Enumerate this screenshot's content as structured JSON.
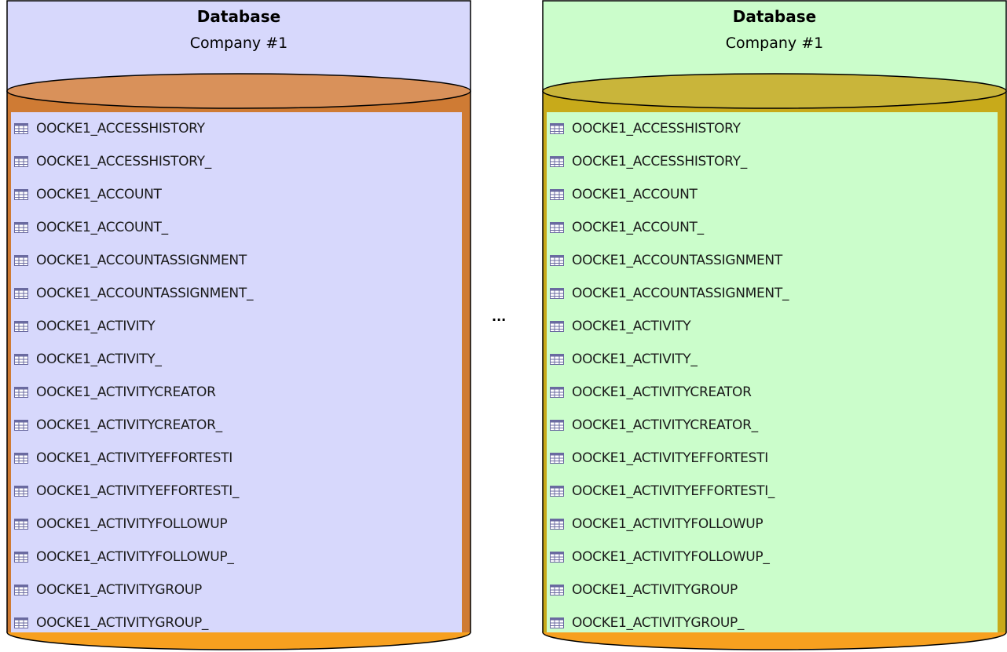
{
  "colors": {
    "left_body": "#d7d8fc",
    "left_rim": "#cf7b34",
    "left_top_ellipse": "#d9915a",
    "left_bottom": "#f7a01f",
    "right_body": "#cbfdcb",
    "right_rim": "#c8aa1a",
    "right_top_ellipse": "#c9b53a",
    "right_bottom": "#f7a01f",
    "outline": "#000000",
    "icon_table": "#6a6aa0"
  },
  "databases": [
    {
      "title": "Database",
      "subtitle": "Company #1",
      "icon": "table-icon",
      "tables": [
        "OOCKE1_ACCESSHISTORY",
        "OOCKE1_ACCESSHISTORY_",
        "OOCKE1_ACCOUNT",
        "OOCKE1_ACCOUNT_",
        "OOCKE1_ACCOUNTASSIGNMENT",
        "OOCKE1_ACCOUNTASSIGNMENT_",
        "OOCKE1_ACTIVITY",
        "OOCKE1_ACTIVITY_",
        "OOCKE1_ACTIVITYCREATOR",
        "OOCKE1_ACTIVITYCREATOR_",
        "OOCKE1_ACTIVITYEFFORTESTI",
        "OOCKE1_ACTIVITYEFFORTESTI_",
        "OOCKE1_ACTIVITYFOLLOWUP",
        "OOCKE1_ACTIVITYFOLLOWUP_",
        "OOCKE1_ACTIVITYGROUP",
        "OOCKE1_ACTIVITYGROUP_"
      ]
    },
    {
      "title": "Database",
      "subtitle": "Company #1",
      "icon": "table-icon",
      "tables": [
        "OOCKE1_ACCESSHISTORY",
        "OOCKE1_ACCESSHISTORY_",
        "OOCKE1_ACCOUNT",
        "OOCKE1_ACCOUNT_",
        "OOCKE1_ACCOUNTASSIGNMENT",
        "OOCKE1_ACCOUNTASSIGNMENT_",
        "OOCKE1_ACTIVITY",
        "OOCKE1_ACTIVITY_",
        "OOCKE1_ACTIVITYCREATOR",
        "OOCKE1_ACTIVITYCREATOR_",
        "OOCKE1_ACTIVITYEFFORTESTI",
        "OOCKE1_ACTIVITYEFFORTESTI_",
        "OOCKE1_ACTIVITYFOLLOWUP",
        "OOCKE1_ACTIVITYFOLLOWUP_",
        "OOCKE1_ACTIVITYGROUP",
        "OOCKE1_ACTIVITYGROUP_"
      ]
    }
  ],
  "separator": "..."
}
